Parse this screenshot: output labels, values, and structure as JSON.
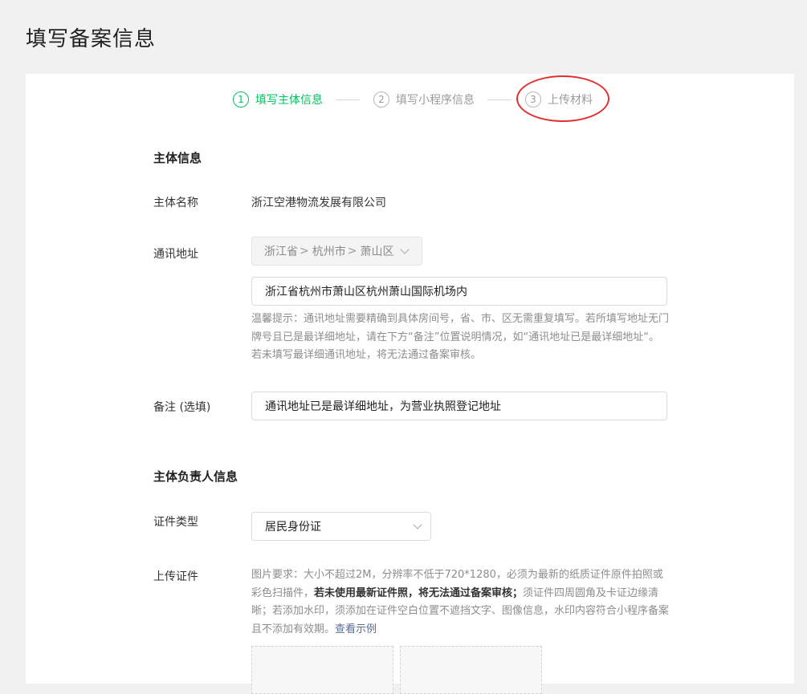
{
  "page_title": "填写备案信息",
  "steps": [
    {
      "num": "1",
      "label": "填写主体信息",
      "active": true
    },
    {
      "num": "2",
      "label": "填写小程序信息",
      "active": false
    },
    {
      "num": "3",
      "label": "上传材料",
      "active": false
    }
  ],
  "subject": {
    "section_title": "主体信息",
    "name_label": "主体名称",
    "name_value": "浙江空港物流发展有限公司",
    "address_label": "通讯地址",
    "province": "浙江省",
    "city": "杭州市",
    "district": "萧山区",
    "region_sep": ">",
    "address_detail": "浙江省杭州市萧山区杭州萧山国际机场内",
    "address_hint": "温馨提示：通讯地址需要精确到具体房间号，省、市、区无需重复填写。若所填写地址无门牌号且已是最详细地址，请在下方“备注”位置说明情况，如“通讯地址已是最详细地址“。若未填写最详细通讯地址，将无法通过备案审核。",
    "remark_label": "备注 (选填)",
    "remark_value": "通讯地址已是最详细地址，为营业执照登记地址"
  },
  "principal": {
    "section_title": "主体负责人信息",
    "id_type_label": "证件类型",
    "id_type_value": "居民身份证",
    "upload_label": "上传证件",
    "upload_hint_part1": "图片要求：大小不超过2M，分辨率不低于720*1280，必须为最新的纸质证件原件拍照或彩色扫描件，",
    "upload_hint_bold": "若未使用最新证件照，将无法通过备案审核；",
    "upload_hint_part2": "须证件四周圆角及卡证边缘清晰；若添加水印，须添加在证件空白位置不遮挡文字、图像信息，水印内容符合小程序备案且不添加有效期。",
    "view_example": "查看示例"
  },
  "colors": {
    "accent_green": "#07c160",
    "annotation_red": "#e32e2e",
    "link_blue": "#576b95"
  }
}
